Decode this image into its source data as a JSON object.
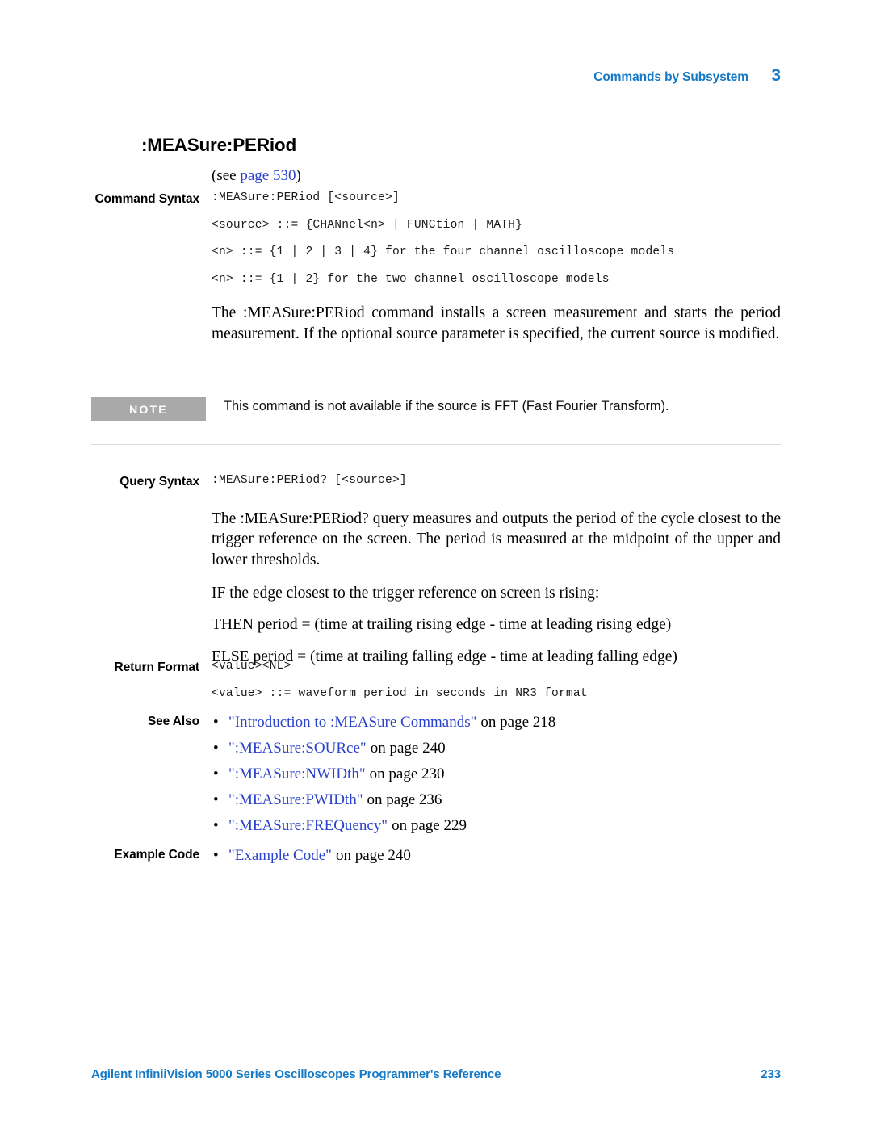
{
  "header": {
    "title": "Commands by Subsystem",
    "chapter": "3"
  },
  "page_title": ":MEASure:PERiod",
  "see_reference": {
    "prefix": "(see ",
    "link": "page 530",
    "suffix": ")"
  },
  "sections": {
    "command_syntax": {
      "label": "Command Syntax",
      "lines": [
        ":MEASure:PERiod [<source>]",
        "<source> ::= {CHANnel<n> | FUNCtion | MATH}",
        "<n> ::= {1 | 2 | 3 | 4} for the four channel oscilloscope models",
        "<n> ::= {1 | 2} for the two channel oscilloscope models"
      ],
      "description": "The :MEASure:PERiod command installs a screen measurement and starts the period measurement. If the optional source parameter is specified, the current source is modified."
    },
    "note": {
      "badge": "NOTE",
      "text": "This command is not available if the source is FFT (Fast Fourier Transform)."
    },
    "query_syntax": {
      "label": "Query Syntax",
      "line": ":MEASure:PERiod? [<source>]",
      "description": "The :MEASure:PERiod? query measures and outputs the period of the cycle closest to the trigger reference on the screen. The period is measured at the midpoint of the upper and lower thresholds.",
      "condition_if": "IF the edge closest to the trigger reference on screen is rising:",
      "condition_then": "THEN period = (time at trailing rising edge - time at leading rising edge)",
      "condition_else": "ELSE period = (time at trailing falling edge - time at leading falling edge)"
    },
    "return_format": {
      "label": "Return Format",
      "lines": [
        "<value><NL>",
        "<value> ::= waveform period in seconds in NR3 format"
      ]
    },
    "see_also": {
      "label": "See Also",
      "bullet": "•",
      "items": [
        {
          "link": "\"Introduction to :MEASure Commands\"",
          "tail": "on page 218"
        },
        {
          "link": "\":MEASure:SOURce\"",
          "tail": "on page 240"
        },
        {
          "link": "\":MEASure:NWIDth\"",
          "tail": "on page 230"
        },
        {
          "link": "\":MEASure:PWIDth\"",
          "tail": "on page 236"
        },
        {
          "link": "\":MEASure:FREQuency\"",
          "tail": "on page 229"
        }
      ]
    },
    "example_code": {
      "label": "Example Code",
      "bullet": "•",
      "items": [
        {
          "link": "\"Example Code\"",
          "tail": "on page 240"
        }
      ]
    }
  },
  "footer": {
    "title": "Agilent InfiniiVision 5000 Series Oscilloscopes Programmer's Reference",
    "page_number": "233"
  },
  "colors": {
    "brand_blue": "#1579c6",
    "link_blue": "#2b42cc",
    "note_gray": "#a9a9a9",
    "divider": "#dcdcdc"
  }
}
